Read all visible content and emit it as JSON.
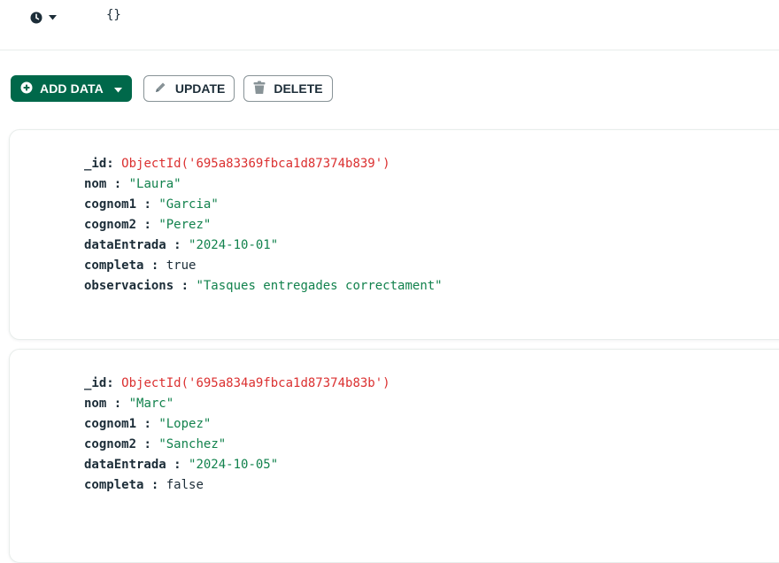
{
  "query_bar": {
    "filter_value": "{}"
  },
  "toolbar": {
    "add_data_label": "ADD DATA",
    "update_label": "UPDATE",
    "delete_label": "DELETE"
  },
  "documents": [
    {
      "fields": [
        {
          "key": "_id",
          "sep": ": ",
          "value": "ObjectId('695a83369fbca1d87374b839')",
          "type": "oid"
        },
        {
          "key": "nom",
          "sep": " : ",
          "value": "\"Laura\"",
          "type": "str"
        },
        {
          "key": "cognom1",
          "sep": " : ",
          "value": "\"Garcia\"",
          "type": "str"
        },
        {
          "key": "cognom2",
          "sep": " : ",
          "value": "\"Perez\"",
          "type": "str"
        },
        {
          "key": "dataEntrada",
          "sep": " : ",
          "value": "\"2024-10-01\"",
          "type": "str"
        },
        {
          "key": "completa",
          "sep": " : ",
          "value": "true",
          "type": "bool"
        },
        {
          "key": "observacions",
          "sep": " : ",
          "value": "\"Tasques entregades correctament\"",
          "type": "str"
        }
      ]
    },
    {
      "fields": [
        {
          "key": "_id",
          "sep": ": ",
          "value": "ObjectId('695a834a9fbca1d87374b83b')",
          "type": "oid"
        },
        {
          "key": "nom",
          "sep": " : ",
          "value": "\"Marc\"",
          "type": "str"
        },
        {
          "key": "cognom1",
          "sep": " : ",
          "value": "\"Lopez\"",
          "type": "str"
        },
        {
          "key": "cognom2",
          "sep": " : ",
          "value": "\"Sanchez\"",
          "type": "str"
        },
        {
          "key": "dataEntrada",
          "sep": " : ",
          "value": "\"2024-10-05\"",
          "type": "str"
        },
        {
          "key": "completa",
          "sep": " : ",
          "value": "false",
          "type": "bool"
        }
      ]
    }
  ],
  "colors": {
    "accent_green": "#00684a",
    "objectid_red": "#db3030",
    "string_green": "#12824d",
    "text_dark": "#1c2d38"
  },
  "icons": {
    "history": "clock-icon",
    "history_menu": "caret-down-icon",
    "add": "plus-circle-icon",
    "add_menu": "caret-down-icon",
    "update": "pencil-icon",
    "delete": "trash-icon"
  }
}
